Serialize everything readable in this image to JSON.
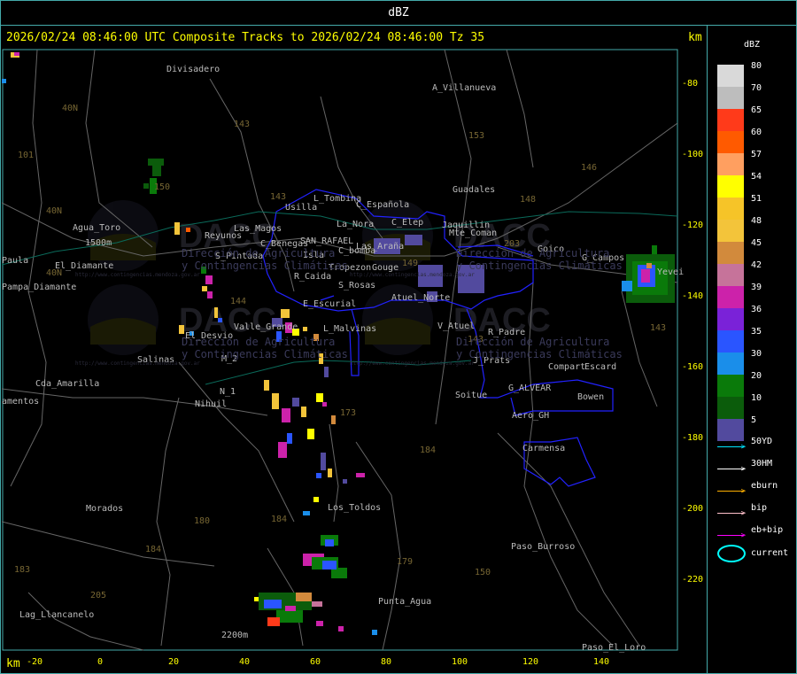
{
  "window": {
    "title": "dBZ"
  },
  "header": {
    "text": "2026/02/24 08:46:00 UTC Composite Tracks to 2026/02/24 08:46:00 Tz 35",
    "km_label": "km",
    "km_label_bottom": "km"
  },
  "axes": {
    "y_ticks": [
      "-80",
      "-100",
      "-120",
      "-140",
      "-160",
      "-180",
      "-200",
      "-220"
    ],
    "x_ticks": [
      "-20",
      "0",
      "20",
      "40",
      "60",
      "80",
      "100",
      "120",
      "140"
    ]
  },
  "legend": {
    "unit": "dBZ",
    "levels": [
      {
        "label": "80",
        "color": "#d9d9d9"
      },
      {
        "label": "70",
        "color": "#bdbdbd"
      },
      {
        "label": "65",
        "color": "#ff3a1a"
      },
      {
        "label": "60",
        "color": "#ff5a00"
      },
      {
        "label": "57",
        "color": "#ff9f60"
      },
      {
        "label": "54",
        "color": "#ffff00"
      },
      {
        "label": "51",
        "color": "#f6c428"
      },
      {
        "label": "48",
        "color": "#f3c43a"
      },
      {
        "label": "45",
        "color": "#d28a3c"
      },
      {
        "label": "42",
        "color": "#c6739a"
      },
      {
        "label": "39",
        "color": "#cc22aa"
      },
      {
        "label": "36",
        "color": "#7a22d8"
      },
      {
        "label": "35",
        "color": "#2a55ff"
      },
      {
        "label": "30",
        "color": "#1a8eea"
      },
      {
        "label": "20",
        "color": "#0a7a0a"
      },
      {
        "label": "10",
        "color": "#0b5c0b"
      },
      {
        "label": "5",
        "color": "#524a9e"
      }
    ],
    "tracks": [
      {
        "label": "50YD",
        "color": "#00e5ff"
      },
      {
        "label": "30HM",
        "color": "#ffffff"
      },
      {
        "label": "eburn",
        "color": "#ffb000"
      },
      {
        "label": "bip",
        "color": "#ffc0cb"
      },
      {
        "label": "eb+bip",
        "color": "#ff00ff"
      }
    ],
    "current_label": "current"
  },
  "places": [
    {
      "name": "Divisadero"
    },
    {
      "name": "A_Villanueva"
    },
    {
      "name": "L_Tombina"
    },
    {
      "name": "C_Española"
    },
    {
      "name": "Usilla"
    },
    {
      "name": "La_Nora"
    },
    {
      "name": "C_Elep"
    },
    {
      "name": "Jaquillin"
    },
    {
      "name": "Guadales"
    },
    {
      "name": "Agua_Toro"
    },
    {
      "name": "Reyunos"
    },
    {
      "name": "Las_Magos"
    },
    {
      "name": "C_Benegas"
    },
    {
      "name": "SAN_RAFAEL"
    },
    {
      "name": "C_bomba"
    },
    {
      "name": "Las_Araña"
    },
    {
      "name": "Gouge"
    },
    {
      "name": "Mte_Coman"
    },
    {
      "name": "Goico"
    },
    {
      "name": "G_Campos"
    },
    {
      "name": "Paula"
    },
    {
      "name": "S_Pintada"
    },
    {
      "name": "Isla"
    },
    {
      "name": "Tropezon"
    },
    {
      "name": "El_Diamante"
    },
    {
      "name": "Pampa_Diamante"
    },
    {
      "name": "R_Caida"
    },
    {
      "name": "S_Rosas"
    },
    {
      "name": "Atuel_Norte"
    },
    {
      "name": "E_Escurial"
    },
    {
      "name": "Valle_Grande"
    },
    {
      "name": "L_Malvinas"
    },
    {
      "name": "V_Atuel"
    },
    {
      "name": "R_Padre"
    },
    {
      "name": "El_Desvio"
    },
    {
      "name": "Salinas"
    },
    {
      "name": "M_2"
    },
    {
      "name": "J_Prats"
    },
    {
      "name": "Compart"
    },
    {
      "name": "Escard"
    },
    {
      "name": "Cda_Amarilla"
    },
    {
      "name": "G_ALVEAR"
    },
    {
      "name": "N_1"
    },
    {
      "name": "Bowen"
    },
    {
      "name": "Soitue"
    },
    {
      "name": "Nihuil"
    },
    {
      "name": "amentos"
    },
    {
      "name": "Aero_GH"
    },
    {
      "name": "Carmensa"
    },
    {
      "name": "Morados"
    },
    {
      "name": "Los_Toldos"
    },
    {
      "name": "Paso_Burroso"
    },
    {
      "name": "Lag_Llancanelo"
    },
    {
      "name": "Punta_Agua"
    },
    {
      "name": "Paso_El_Loro"
    },
    {
      "name": "2200m"
    },
    {
      "name": "1500m"
    },
    {
      "name": "Yevei"
    }
  ],
  "route_numbers": [
    "143",
    "153",
    "146",
    "101",
    "40N",
    "40N",
    "148",
    "143",
    "150",
    "149",
    "203",
    "144",
    "40N",
    "143",
    "173",
    "184",
    "180",
    "184",
    "150",
    "179",
    "184",
    "183",
    "205",
    "143"
  ],
  "watermark": {
    "brand": "DACC",
    "line1": "Dirección de Agricultura",
    "line2": "y Contingencias Climáticas",
    "url": "http://www.contingencias.mendoza.gov.ar"
  }
}
